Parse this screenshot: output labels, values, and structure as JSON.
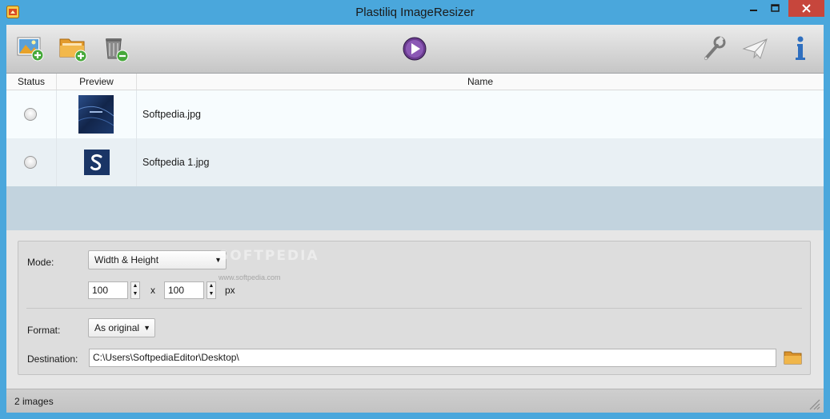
{
  "window": {
    "title": "Plastiliq ImageResizer"
  },
  "toolbar": {
    "buttons": [
      {
        "name": "add-image-button",
        "icon": "add-image-icon"
      },
      {
        "name": "add-folder-button",
        "icon": "add-folder-icon"
      },
      {
        "name": "clear-list-button",
        "icon": "trash-remove-icon"
      },
      {
        "name": "start-button",
        "icon": "play-icon"
      },
      {
        "name": "settings-button",
        "icon": "wrench-icon"
      },
      {
        "name": "feedback-button",
        "icon": "paper-plane-icon"
      },
      {
        "name": "about-button",
        "icon": "info-icon"
      }
    ]
  },
  "list": {
    "columns": {
      "status": "Status",
      "preview": "Preview",
      "name": "Name"
    },
    "rows": [
      {
        "name": "Softpedia.jpg"
      },
      {
        "name": "Softpedia 1.jpg"
      }
    ]
  },
  "settings": {
    "mode_label": "Mode:",
    "mode_value": "Width & Height",
    "width": "100",
    "height": "100",
    "times": "x",
    "unit": "px",
    "format_label": "Format:",
    "format_value": "As original",
    "destination_label": "Destination:",
    "destination_value": "C:\\Users\\SoftpediaEditor\\Desktop\\"
  },
  "watermark": {
    "text": "SOFTPEDIA",
    "url": "www.softpedia.com"
  },
  "status": {
    "text": "2 images"
  },
  "colors": {
    "titlebar": "#4aa7dc",
    "close": "#c7463c",
    "list_bg": "#c2d3de",
    "row_alt": "#e9f0f4"
  }
}
